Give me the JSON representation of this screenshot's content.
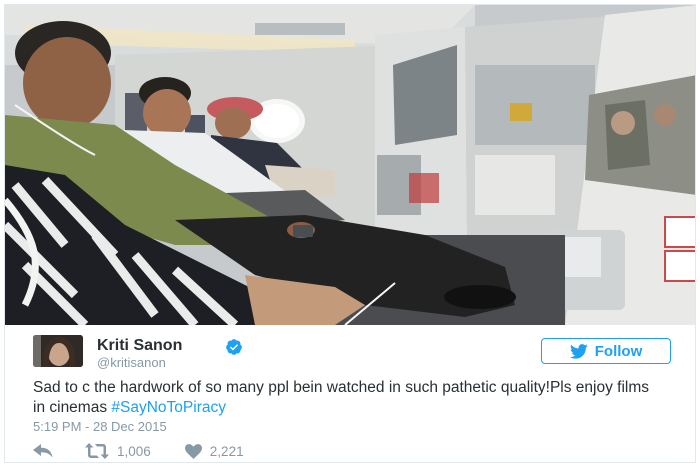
{
  "tweet": {
    "author_name": "Kriti Sanon",
    "handle": "@kritisanon",
    "verified": true,
    "follow_label": "Follow",
    "text_main": "Sad to c the hardwork of so many ppl bein watched in such pathetic quality!Pls enjoy films in cinemas ",
    "hashtag": "#SayNoToPiracy",
    "timestamp": "5:19 PM - 28 Dec 2015",
    "retweets": "1,006",
    "likes": "2,221"
  },
  "icons": {
    "reply": "reply-icon",
    "retweet": "retweet-icon",
    "like": "heart-icon",
    "follow": "twitter-bird-icon",
    "verified": "verified-badge-icon"
  },
  "colors": {
    "accent": "#1da1f2",
    "muted": "#8899a6",
    "text": "#292f33",
    "border": "#e1e8ed"
  }
}
